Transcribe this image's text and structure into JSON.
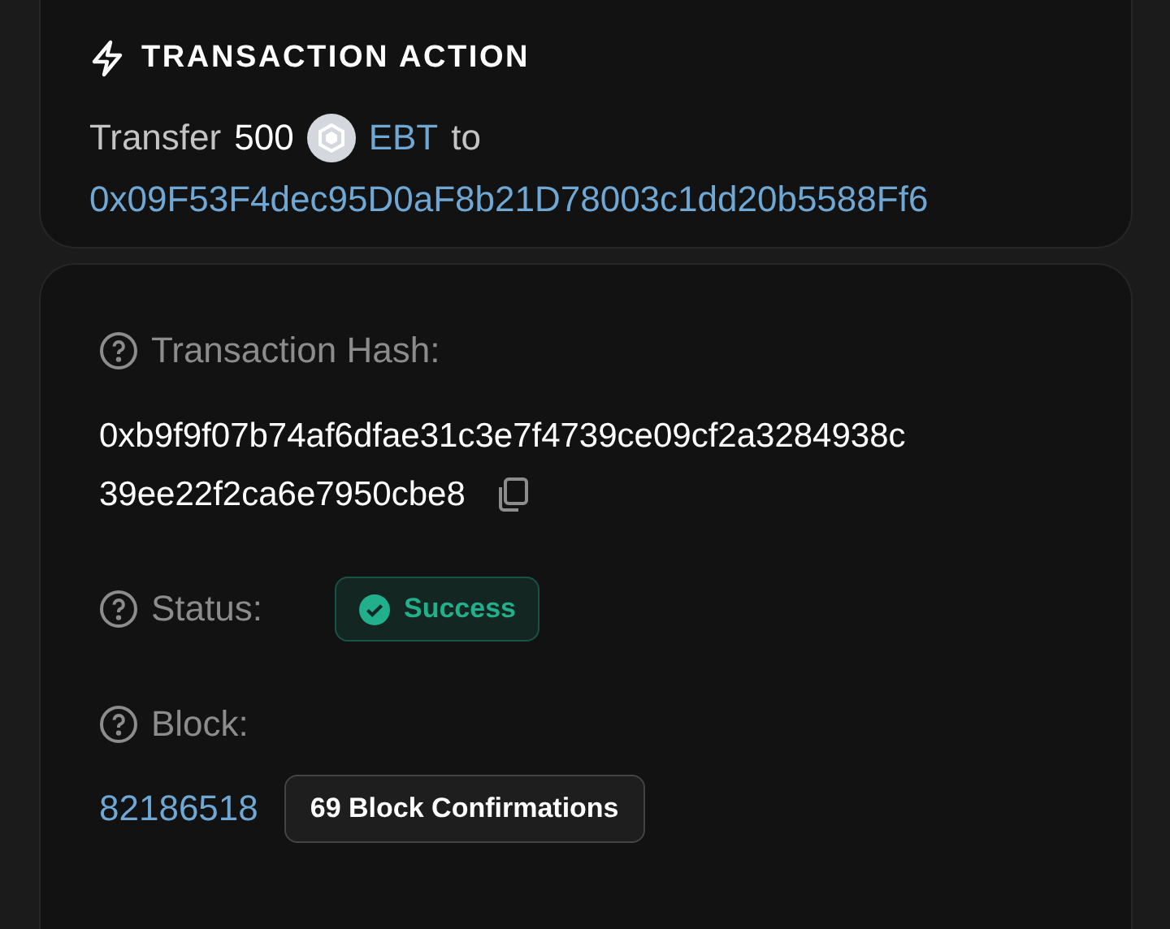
{
  "action": {
    "title": "TRANSACTION ACTION",
    "verb": "Transfer",
    "amount": "500",
    "token": "EBT",
    "preposition": "to",
    "address": "0x09F53F4dec95D0aF8b21D78003c1dd20b5588Ff6"
  },
  "details": {
    "hash_label": "Transaction Hash:",
    "hash_lines": [
      "0xb9f9f07b74af6dfae31c3e7f4739ce09cf2a3284938c",
      "39ee22f2ca6e7950cbe8"
    ],
    "status_label": "Status:",
    "status": {
      "text": "Success",
      "kind": "success"
    },
    "block_label": "Block:",
    "block": "82186518",
    "confirmations": "69 Block Confirmations"
  }
}
